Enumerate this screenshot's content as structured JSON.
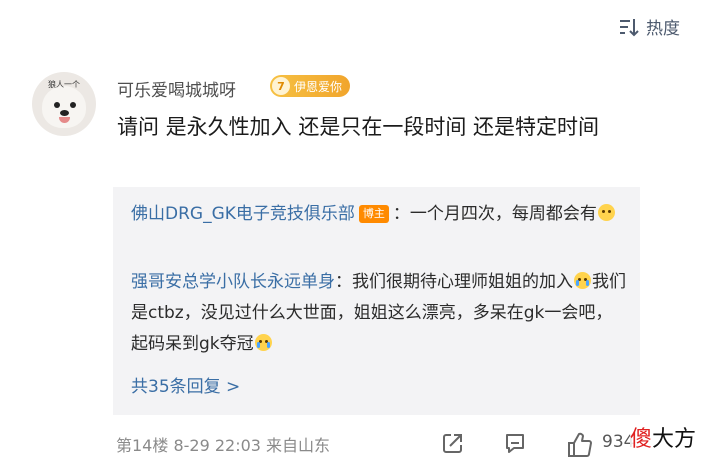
{
  "sort": {
    "label": "热度",
    "icon": "sort-icon"
  },
  "comment": {
    "avatar_caption": "狼人一个",
    "username": "可乐爱喝城城呀",
    "fan_badge": {
      "level": "7",
      "label": "伊恩爱你"
    },
    "text": "请问  是永久性加入  还是只在一段时间  还是特定时间"
  },
  "replies": [
    {
      "name": "佛山DRG_GK电子竞技俱乐部",
      "badge": "博主",
      "text_a": "：一个月四次，每周都会有",
      "emoji_a": "emoji-shy-icon"
    },
    {
      "name": "强哥安总学小队长永远单身",
      "text_a": "：我们很期待心理师姐姐的加入",
      "emoji_a": "emoji-cry-icon",
      "text_b": "我们是ctbz，没见过什么大世面，姐姐这么漂亮，多呆在gk一会吧，起码呆到gk夺冠",
      "emoji_b": "emoji-cry-icon"
    }
  ],
  "more_replies": "共35条回复 >",
  "footer": {
    "meta": "第14楼  8-29 22:03  来自山东"
  },
  "actions": {
    "share_icon": "share-icon",
    "comment_icon": "comment-icon",
    "like_icon": "like-icon",
    "like_count": "934"
  },
  "watermark": {
    "part_a": "傻",
    "part_b": "大方"
  },
  "colors": {
    "link": "#3a6ea5",
    "badge": "#ff8a00",
    "fan_badge": "#f1a52c"
  }
}
